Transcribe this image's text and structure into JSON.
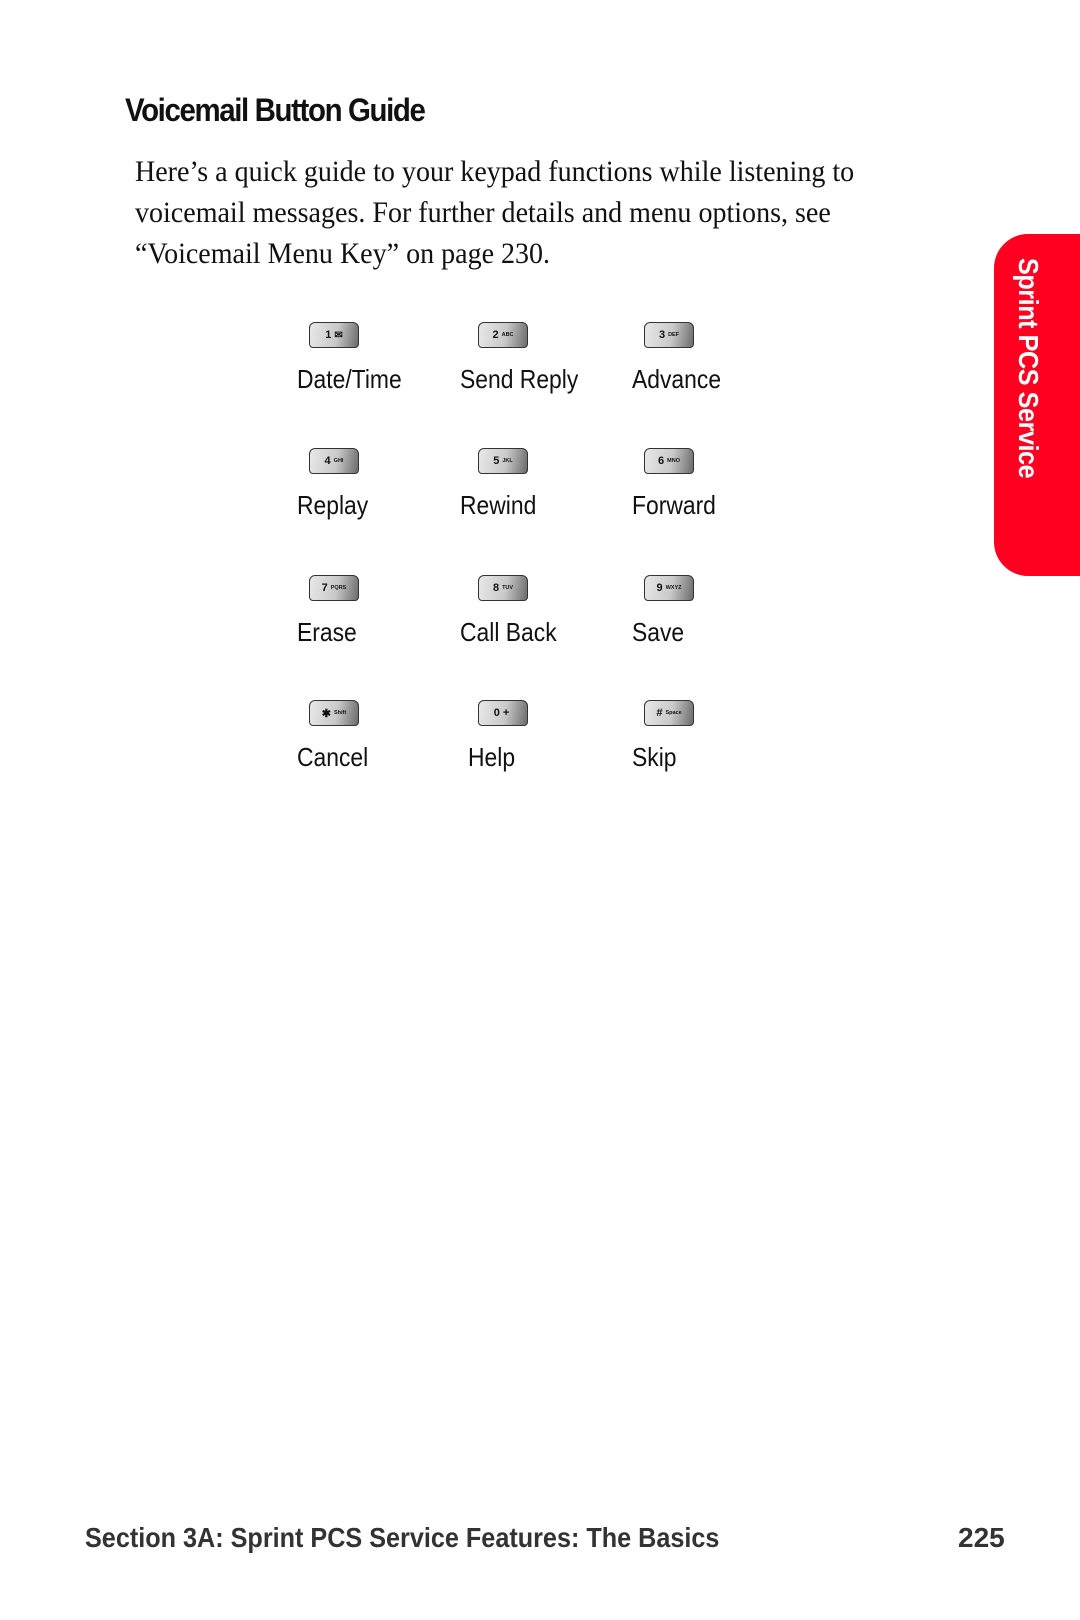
{
  "page": {
    "heading": "Voicemail Button Guide",
    "intro": "Here’s a quick guide to your keypad functions while listening to voicemail messages. For further details and menu options, see “Voicemail Menu Key” on page 230."
  },
  "keypad": [
    {
      "key": "1",
      "sub": "✉",
      "icon": "envelope-icon",
      "label": "Date/Time"
    },
    {
      "key": "2",
      "sub": "ABC",
      "label": "Send Reply"
    },
    {
      "key": "3",
      "sub": "DEF",
      "label": "Advance"
    },
    {
      "key": "4",
      "sub": "GHI",
      "label": "Replay"
    },
    {
      "key": "5",
      "sub": "JKL",
      "label": "Rewind"
    },
    {
      "key": "6",
      "sub": "MNO",
      "label": "Forward"
    },
    {
      "key": "7",
      "sub": "PQRS",
      "label": "Erase"
    },
    {
      "key": "8",
      "sub": "TUV",
      "label": "Call Back"
    },
    {
      "key": "9",
      "sub": "WXYZ",
      "label": "Save"
    },
    {
      "key": "✱",
      "sub": "Shift",
      "label": "Cancel"
    },
    {
      "key": "0 +",
      "sub": "",
      "label": "Help"
    },
    {
      "key": "#",
      "sub": "Space",
      "label": "Skip"
    }
  ],
  "side_tab": {
    "label": "Sprint PCS Service",
    "color": "#ff0020"
  },
  "footer": {
    "section": "Section 3A: Sprint PCS Service Features: The Basics",
    "page_number": "225"
  }
}
